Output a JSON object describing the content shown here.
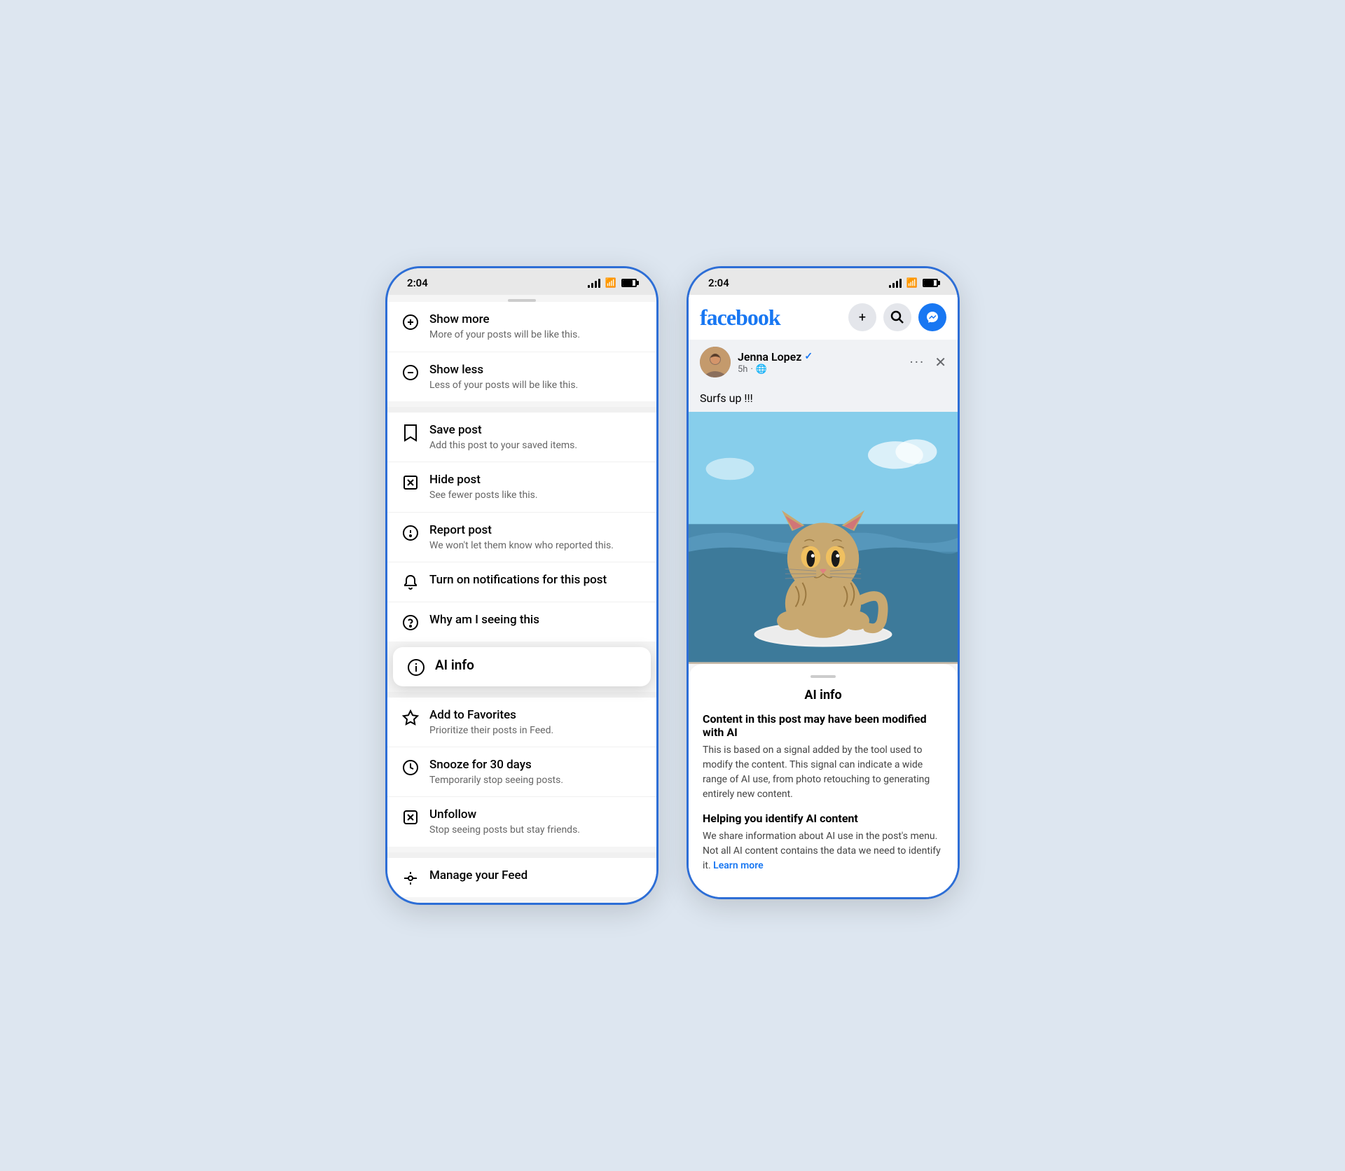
{
  "phone1": {
    "statusBar": {
      "time": "2:04"
    },
    "menuSections": [
      {
        "id": "section1",
        "items": [
          {
            "id": "show-more",
            "icon": "⊕",
            "title": "Show more",
            "subtitle": "More of your posts will be like this."
          },
          {
            "id": "show-less",
            "icon": "⊖",
            "title": "Show less",
            "subtitle": "Less of your posts will be like this."
          }
        ]
      },
      {
        "id": "section2",
        "items": [
          {
            "id": "save-post",
            "icon": "🔖",
            "title": "Save post",
            "subtitle": "Add this post to your saved items."
          },
          {
            "id": "hide-post",
            "icon": "✖",
            "title": "Hide post",
            "subtitle": "See fewer posts like this."
          },
          {
            "id": "report-post",
            "icon": "⚠",
            "title": "Report post",
            "subtitle": "We won't let them know who reported this."
          },
          {
            "id": "notifications",
            "icon": "🔔",
            "title": "Turn on notifications for this post",
            "subtitle": ""
          },
          {
            "id": "why-seeing",
            "icon": "?",
            "title": "Why am I seeing this",
            "subtitle": ""
          }
        ]
      },
      {
        "id": "ai-info",
        "item": {
          "id": "ai-info-item",
          "icon": "ℹ",
          "title": "AI info",
          "subtitle": ""
        }
      },
      {
        "id": "section3",
        "items": [
          {
            "id": "add-favorites",
            "icon": "☆",
            "title": "Add to Favorites",
            "subtitle": "Prioritize their posts in Feed."
          },
          {
            "id": "snooze",
            "icon": "⏱",
            "title": "Snooze for 30 days",
            "subtitle": "Temporarily stop seeing posts."
          },
          {
            "id": "unfollow",
            "icon": "✖",
            "title": "Unfollow",
            "subtitle": "Stop seeing posts but stay friends."
          }
        ]
      },
      {
        "id": "section4",
        "items": [
          {
            "id": "manage-feed",
            "icon": "⚙",
            "title": "Manage your Feed",
            "subtitle": ""
          }
        ]
      }
    ]
  },
  "phone2": {
    "statusBar": {
      "time": "2:04"
    },
    "header": {
      "logo": "facebook",
      "addLabel": "+",
      "searchLabel": "🔍",
      "messengerLabel": "💬"
    },
    "post": {
      "username": "Jenna Lopez",
      "verified": true,
      "timeAgo": "5h",
      "privacy": "🌐",
      "caption": "Surfs up !!!",
      "imageAlt": "Cat on surfboard at beach"
    },
    "aiPanel": {
      "handleVisible": true,
      "title": "AI info",
      "section1Title": "Content in this post may have been modified with AI",
      "section1Text": "This is based on a signal added by the tool used to modify the content. This signal can indicate a wide range of AI use, from photo retouching to generating entirely new content.",
      "section2Title": "Helping you identify AI content",
      "section2Text": "We share information about AI use in the post's menu. Not all AI content contains the data we need to identify it.",
      "learnMore": "Learn more"
    }
  }
}
